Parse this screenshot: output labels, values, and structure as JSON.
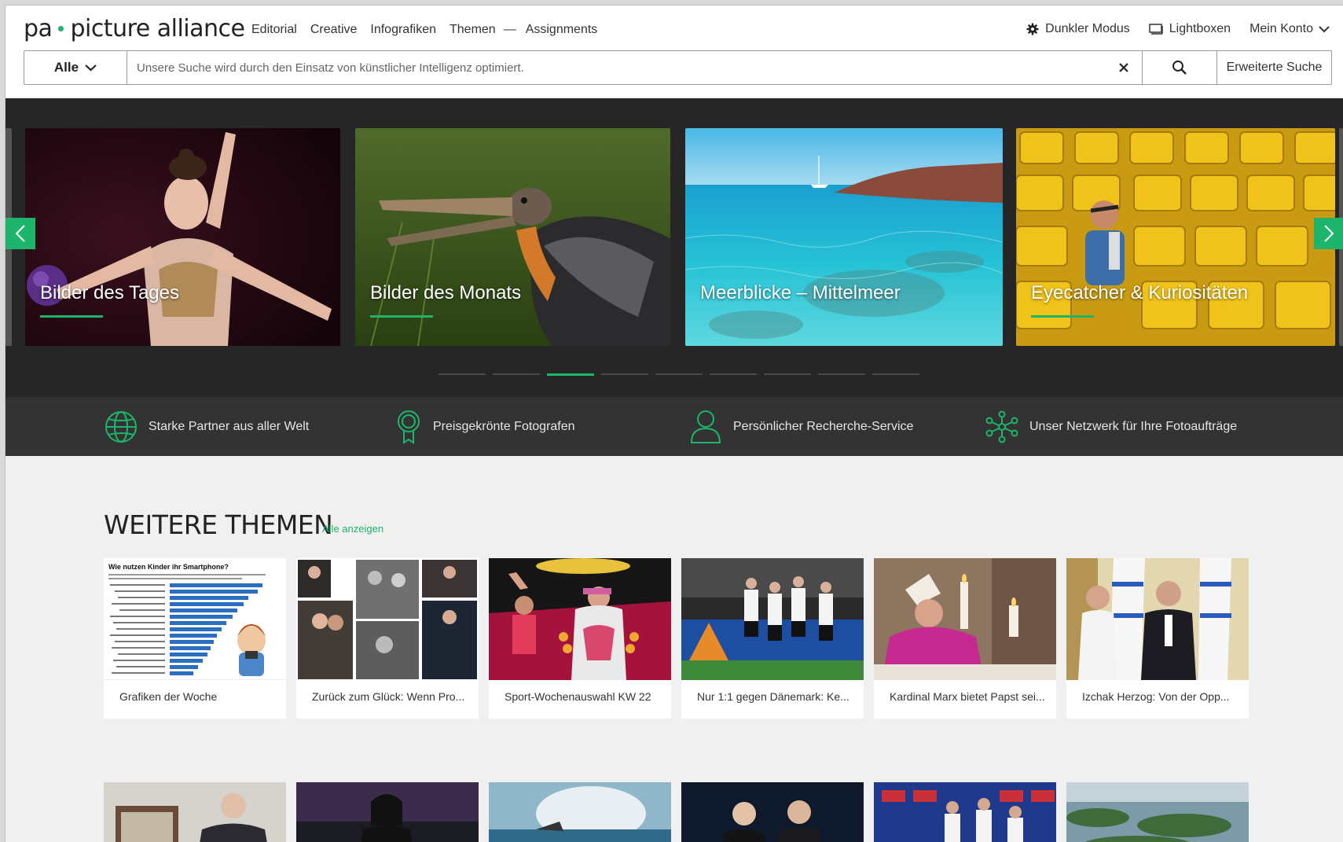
{
  "header": {
    "logo_left": "pa",
    "logo_right": "picture alliance",
    "nav": [
      "Editorial",
      "Creative",
      "Infografiken",
      "Themen"
    ],
    "nav_dash": "—",
    "nav_assignments": "Assignments",
    "dark_mode": "Dunkler Modus",
    "lightboxes": "Lightboxen",
    "account": "Mein Konto"
  },
  "search": {
    "scope": "Alle",
    "placeholder": "Unsere Suche wird durch den Einsatz von künstlicher Intelligenz optimiert.",
    "advanced": "Erweiterte Suche"
  },
  "carousel": {
    "slides": [
      {
        "title": "Bilder des Tages"
      },
      {
        "title": "Bilder des Monats"
      },
      {
        "title": "Meerblicke – Mittelmeer"
      },
      {
        "title": "Eyecatcher & Kuriositäten"
      }
    ],
    "page_count": 9,
    "active_page": 3
  },
  "features": [
    {
      "label": "Starke Partner aus aller Welt",
      "icon": "globe-icon"
    },
    {
      "label": "Preisgekrönte Fotografen",
      "icon": "award-icon"
    },
    {
      "label": "Persönlicher Recherche-Service",
      "icon": "person-icon"
    },
    {
      "label": "Unser Netzwerk für Ihre Fotoaufträge",
      "icon": "network-icon"
    }
  ],
  "themes": {
    "heading": "WEITERE THEMEN",
    "all_link": "Alle anzeigen",
    "cards": [
      {
        "caption": "Grafiken der Woche",
        "chart_title": "Wie nutzen Kinder ihr Smartphone?"
      },
      {
        "caption": "Zurück zum Glück: Wenn Pro..."
      },
      {
        "caption": "Sport-Wochenauswahl KW 22"
      },
      {
        "caption": "Nur 1:1 gegen Dänemark: Ke..."
      },
      {
        "caption": "Kardinal Marx bietet Papst sei..."
      },
      {
        "caption": "Izchak Herzog: Von der Opp..."
      }
    ]
  },
  "colors": {
    "accent": "#1db46b",
    "dark_bg": "#262626",
    "strip_bg": "#333333",
    "themes_bg": "#f0f0f0"
  }
}
